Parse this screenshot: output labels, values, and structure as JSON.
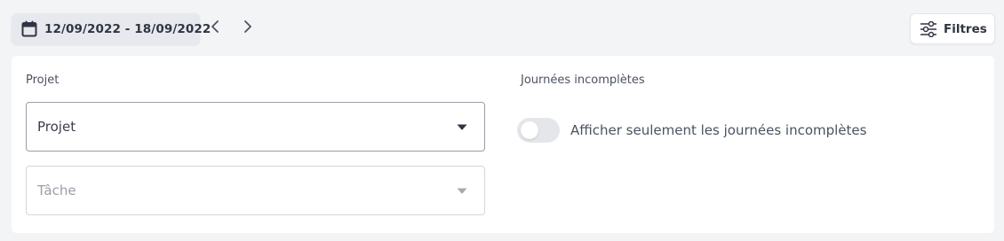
{
  "toolbar": {
    "date_range": "12/09/2022 - 18/09/2022",
    "filters_label": "Filtres"
  },
  "filters": {
    "projet_section_label": "Projet",
    "projet_select_value": "Projet",
    "tache_select_value": "Tâche",
    "journees_section_label": "Journées incomplètes",
    "toggle_label": "Afficher seulement les journées incomplètes",
    "toggle_on": false
  },
  "icons": {
    "calendar": "calendar-icon",
    "prev": "chevron-left-icon",
    "next": "chevron-right-icon",
    "filters": "sliders-icon",
    "caret": "caret-down-icon"
  }
}
